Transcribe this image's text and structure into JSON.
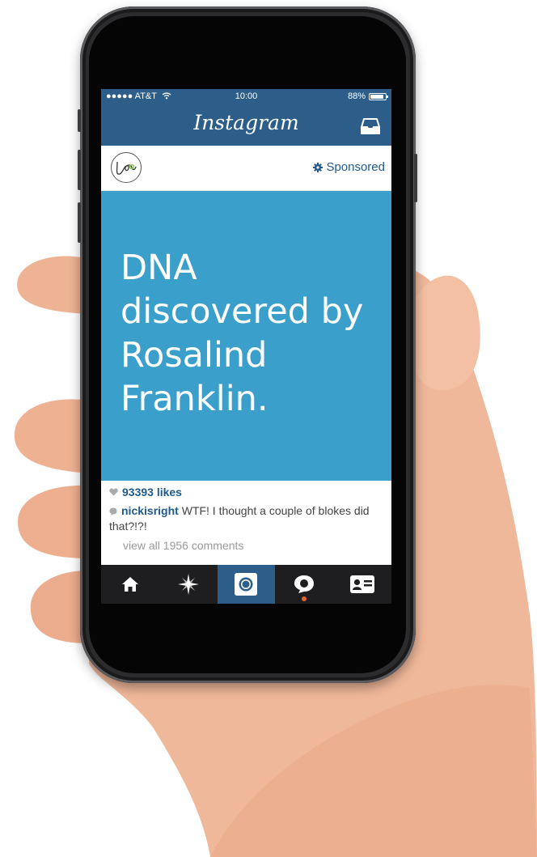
{
  "status_bar": {
    "carrier": "●●●●● AT&T",
    "time": "10:00",
    "battery": "88%",
    "battery_level": 0.88
  },
  "nav": {
    "title": "Instagram",
    "inbox_icon": "inbox-tray-icon"
  },
  "post": {
    "avatar_icon": "love-logo-icon",
    "sponsored_label": "Sponsored",
    "sponsored_icon": "gear-icon",
    "headline": "DNA discovered by Rosalind Franklin.",
    "image_color": "#3aa0cb",
    "likes": "93393 likes",
    "comment_user": "nickisright",
    "comment_text": "WTF! I thought a couple of blokes did that?!?!",
    "view_all": "view all 1956 comments"
  },
  "tabbar": {
    "tabs": [
      {
        "name": "home",
        "icon": "home-icon"
      },
      {
        "name": "explore",
        "icon": "explore-star-icon"
      },
      {
        "name": "camera",
        "icon": "camera-icon",
        "active": true
      },
      {
        "name": "activity",
        "icon": "activity-bubble-icon",
        "notification": true
      },
      {
        "name": "profile",
        "icon": "profile-card-icon"
      }
    ]
  },
  "colors": {
    "brand": "#2d5e8a",
    "link": "#1f5a8c",
    "notification": "#e9612b"
  }
}
